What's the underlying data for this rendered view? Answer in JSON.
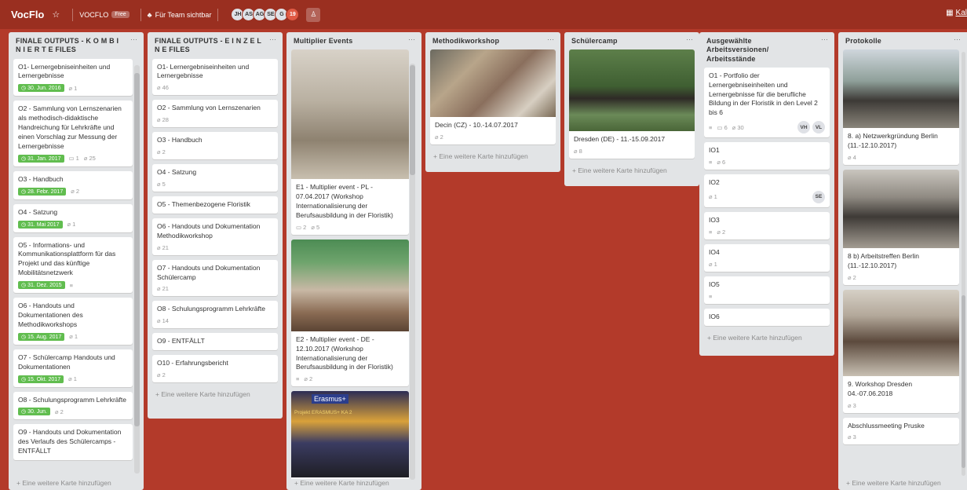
{
  "header": {
    "board_title": "VocFlo",
    "org_name": "VOCFLO",
    "org_badge": "Free",
    "visibility": "Für Team sichtbar",
    "members": [
      "JH",
      "AS",
      "AG",
      "SE",
      "G"
    ],
    "member_count": "19",
    "right_label": "Kal"
  },
  "lists": [
    {
      "title": "FINALE OUTPUTS - K O M B I N I E R T E FILES",
      "cards": [
        {
          "text": "O1- Lernergebniseinheiten und Lernergebnisse",
          "due": "30. Jun. 2016",
          "attachments": "1"
        },
        {
          "text": "O2 - Sammlung von Lernszenarien als methodisch-didaktische Handreichung für Lehrkräfte und einen Vorschlag zur Messung der Lernergebnisse",
          "due": "31. Jan. 2017",
          "comments": "1",
          "attachments": "25"
        },
        {
          "text": "O3 - Handbuch",
          "due": "28. Febr. 2017",
          "attachments": "2"
        },
        {
          "text": "O4 - Satzung",
          "due": "31. Mai 2017",
          "attachments": "1"
        },
        {
          "text": "O5 - Informations- und Kommunikationsplattform für das Projekt und das künftige Mobilitätsnetzwerk",
          "due": "31. Dez. 2015",
          "description": "≡"
        },
        {
          "text": "O6 - Handouts und Dokumentationen des Methodikworkshops",
          "due": "15. Aug. 2017",
          "attachments": "1"
        },
        {
          "text": "O7 - Schülercamp Handouts und Dokumentationen",
          "due": "15. Okt. 2017",
          "attachments": "1"
        },
        {
          "text": "O8 - Schulungsprogramm Lehrkräfte",
          "due": "30. Jun.",
          "attachments": "2"
        },
        {
          "text": "O9 - Handouts und Dokumentation des Verlaufs des Schülercamps - ENTFÄLLT"
        }
      ],
      "add_card": "+ Eine weitere Karte hinzufügen"
    },
    {
      "title": "FINALE OUTPUTS - E I N Z E L N E FILES",
      "cards": [
        {
          "text": "O1- Lernergebniseinheiten und Lernergebnisse",
          "attachments": "46"
        },
        {
          "text": "O2 - Sammlung von Lernszenarien",
          "attachments": "28"
        },
        {
          "text": "O3 - Handbuch",
          "attachments": "2"
        },
        {
          "text": "O4 - Satzung",
          "attachments": "5"
        },
        {
          "text": "O5 - Themenbezogene Floristik"
        },
        {
          "text": "O6 - Handouts und Dokumentation Methodikworkshop",
          "attachments": "21"
        },
        {
          "text": "O7 - Handouts und Dokumentation Schülercamp",
          "attachments": "21"
        },
        {
          "text": "O8 - Schulungsprogramm Lehrkräfte",
          "attachments": "14"
        },
        {
          "text": "O9 - ENTFÄLLT"
        },
        {
          "text": "O10 - Erfahrungsbericht",
          "attachments": "2"
        }
      ],
      "add_card": "+ Eine weitere Karte hinzufügen"
    },
    {
      "title": "Multiplier Events",
      "cards": [
        {
          "text": "E1 - Multiplier event - PL - 07.04.2017 (Workshop Internationalisierung der Berufsausbildung in der Floristik)",
          "comments": "2",
          "attachments": "5"
        },
        {
          "text": "E2 - Multiplier event - DE - 12.10.2017 (Workshop Internationalisierung der Berufsausbildung in der Floristik)",
          "description": "≡",
          "attachments": "2"
        },
        {
          "text": ""
        }
      ],
      "add_card": "+ Eine weitere Karte hinzufügen",
      "image_captions": [
        "Erasmus+",
        "Projekt ERASMUS+ KA 2"
      ]
    },
    {
      "title": "Methodikworkshop",
      "cards": [
        {
          "text": "Decin (CZ) - 10.-14.07.2017",
          "attachments": "2"
        }
      ],
      "add_card": "+ Eine weitere Karte hinzufügen"
    },
    {
      "title": "Schülercamp",
      "cards": [
        {
          "text": "Dresden (DE) - 11.-15.09.2017",
          "attachments": "8"
        }
      ],
      "add_card": "+ Eine weitere Karte hinzufügen"
    },
    {
      "title": "Ausgewählte Arbeitsversionen/ Arbeitsstände",
      "cards": [
        {
          "text": "O1 - Portfolio der Lernergebniseinheiten und Lernergebnisse für die berufliche Bildung in der Floristik in den Level 2 bis 6",
          "description": "≡",
          "comments": "6",
          "attachments": "30",
          "members": [
            "VH",
            "VL"
          ]
        },
        {
          "text": "IO1",
          "description": "≡",
          "attachments": "6"
        },
        {
          "text": "IO2",
          "attachments": "1",
          "members": [
            "SE"
          ]
        },
        {
          "text": "IO3",
          "description": "≡",
          "attachments": "2"
        },
        {
          "text": "IO4",
          "attachments": "1"
        },
        {
          "text": "IO5",
          "description": "≡"
        },
        {
          "text": "IO6"
        }
      ],
      "add_card": "+ Eine weitere Karte hinzufügen"
    },
    {
      "title": "Protokolle",
      "cards": [
        {
          "text": "8. a) Netzwerkgründung Berlin (11.-12.10.2017)",
          "attachments": "4"
        },
        {
          "text": "8 b) Arbeitstreffen Berlin (11.-12.10.2017)",
          "attachments": "2"
        },
        {
          "text": "9. Workshop Dresden 04.-07.06.2018",
          "attachments": "3"
        },
        {
          "text": "Abschlussmeeting Pruske",
          "attachments": "3"
        }
      ],
      "add_card": "+ Eine weitere Karte hinzufügen"
    }
  ]
}
